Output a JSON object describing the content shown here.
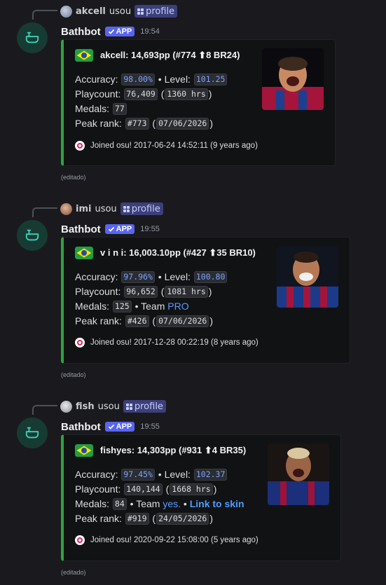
{
  "messages": [
    {
      "reply": {
        "user": "akcell",
        "used": "usou",
        "command": "profile"
      },
      "bot_name": "Bathbot",
      "app_badge": "APP",
      "time": "19:54",
      "title": "akcell: 14,693pp (#774 ⬆8 BR24)",
      "accuracy_label": "Accuracy:",
      "accuracy": "98.00%",
      "level_label": "• Level:",
      "level": "101.25",
      "playcount_label": "Playcount:",
      "playcount": "76,409",
      "hours": "1360 hrs",
      "medals_label": "Medals:",
      "medals": "77",
      "peak_label": "Peak rank:",
      "peak_rank": "#773",
      "peak_date": "07/06/2026",
      "joined": "Joined osu! 2017-06-24 14:52:11 (9 years ago)",
      "edited": "(editado)"
    },
    {
      "reply": {
        "user": "imi",
        "used": "usou",
        "command": "profile"
      },
      "bot_name": "Bathbot",
      "app_badge": "APP",
      "time": "19:55",
      "title": "v i n i: 16,003.10pp (#427 ⬆35 BR10)",
      "accuracy_label": "Accuracy:",
      "accuracy": "97.96%",
      "level_label": "• Level:",
      "level": "100.80",
      "playcount_label": "Playcount:",
      "playcount": "96,652",
      "hours": "1081 hrs",
      "medals_label": "Medals:",
      "medals": "125",
      "team_label": "• Team",
      "team": "PRO",
      "peak_label": "Peak rank:",
      "peak_rank": "#426",
      "peak_date": "07/06/2026",
      "joined": "Joined osu! 2017-12-28 00:22:19 (8 years ago)",
      "edited": "(editado)"
    },
    {
      "reply": {
        "user": "fish",
        "used": "usou",
        "command": "profile"
      },
      "bot_name": "Bathbot",
      "app_badge": "APP",
      "time": "19:55",
      "title": "fishyes: 14,303pp (#931 ⬆4 BR35)",
      "accuracy_label": "Accuracy:",
      "accuracy": "97.45%",
      "level_label": "• Level:",
      "level": "102.37",
      "playcount_label": "Playcount:",
      "playcount": "140,144",
      "hours": "1668 hrs",
      "medals_label": "Medals:",
      "medals": "84",
      "team_label": "• Team",
      "team": "yes.",
      "skin_sep": "•",
      "skin": "Link to skin",
      "peak_label": "Peak rank:",
      "peak_rank": "#919",
      "peak_date": "24/05/2026",
      "joined": "Joined osu! 2020-09-22 15:08:00 (5 years ago)",
      "edited": "(editado)"
    }
  ],
  "colors": {
    "embed_accent": "#2ba640",
    "link": "#5b9bff",
    "app_badge": "#5865f2"
  },
  "icons": [
    "bath-icon",
    "brazil-flag-icon",
    "osu-icon",
    "command-grid-icon",
    "check-icon"
  ]
}
